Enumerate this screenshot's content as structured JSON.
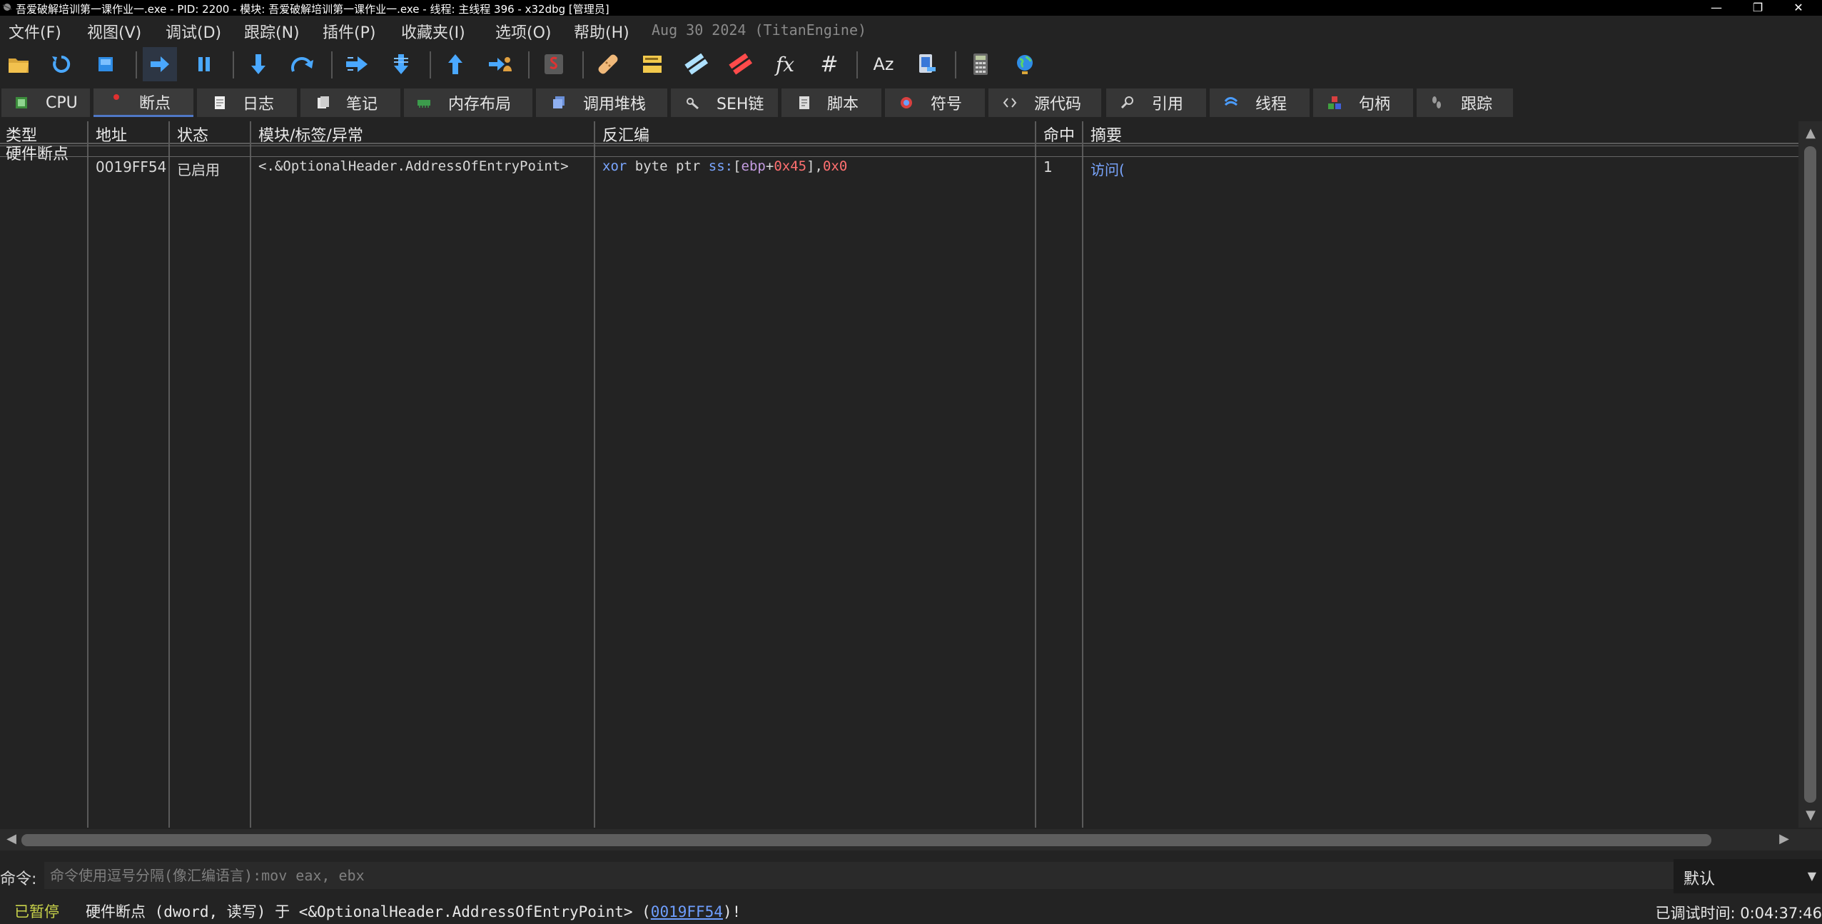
{
  "window": {
    "title": "吾爱破解培训第一课作业一.exe - PID: 2200 - 模块: 吾爱破解培训第一课作业一.exe - 线程: 主线程 396 - x32dbg [管理员]",
    "buttons": {
      "minimize": "—",
      "restore": "❐",
      "close": "✕"
    }
  },
  "menu": {
    "items": [
      "文件(F)",
      "视图(V)",
      "调试(D)",
      "跟踪(N)",
      "插件(P)",
      "收藏夹(I)",
      "选项(O)",
      "帮助(H)"
    ],
    "info": "Aug 30 2024 (TitanEngine)"
  },
  "toolbar": {
    "icons": [
      "open-icon",
      "restart-icon",
      "stop-icon",
      "run-icon",
      "pause-icon",
      "step-into-icon",
      "step-over-icon",
      "trace-into-icon",
      "trace-over-icon",
      "execute-till-return-icon",
      "run-to-user-code-icon",
      "scylla-icon",
      "patch-icon",
      "comment-icon",
      "label-icon",
      "bookmark-icon",
      "function-icon",
      "hash-icon",
      "font-icon",
      "windows-icon",
      "calculator-icon",
      "globe-icon"
    ],
    "fx": "fx",
    "hash": "#",
    "font": "Aᴢ"
  },
  "tabs": [
    {
      "label": "CPU",
      "icon": "cpu-icon"
    },
    {
      "label": "断点",
      "icon": "breakpoint-icon"
    },
    {
      "label": "日志",
      "icon": "log-icon"
    },
    {
      "label": "笔记",
      "icon": "notes-icon"
    },
    {
      "label": "内存布局",
      "icon": "memory-icon"
    },
    {
      "label": "调用堆栈",
      "icon": "callstack-icon"
    },
    {
      "label": "SEH链",
      "icon": "seh-icon"
    },
    {
      "label": "脚本",
      "icon": "script-icon"
    },
    {
      "label": "符号",
      "icon": "symbols-icon"
    },
    {
      "label": "源代码",
      "icon": "source-icon"
    },
    {
      "label": "引用",
      "icon": "references-icon"
    },
    {
      "label": "线程",
      "icon": "threads-icon"
    },
    {
      "label": "句柄",
      "icon": "handles-icon"
    },
    {
      "label": "跟踪",
      "icon": "trace-icon"
    }
  ],
  "active_tab": "断点",
  "breakpoints": {
    "columns": [
      "类型",
      "地址",
      "状态",
      "模块/标签/异常",
      "反汇编",
      "命中",
      "摘要"
    ],
    "group": "硬件断点",
    "row": {
      "address": "0019FF54",
      "state": "已启用",
      "module": "<.&OptionalHeader.AddressOfEntryPoint>",
      "disasm": {
        "mnemonic": "xor",
        "size": "byte ptr",
        "segment": "ss:",
        "open": "[",
        "reg": "ebp",
        "plus": "+",
        "offset": "0x45",
        "close": "],",
        "imm": "0x0"
      },
      "hits": "1",
      "summary": "访问("
    }
  },
  "command": {
    "label": "命令:",
    "placeholder": "命令使用逗号分隔(像汇编语言):mov eax, ebx",
    "value": "",
    "mode": "默认"
  },
  "status": {
    "state": "已暂停",
    "message_prefix": "硬件断点 (dword, 读写) 于 <&OptionalHeader.AddressOfEntryPoint> (",
    "link": "0019FF54",
    "message_suffix": ")!",
    "time": "已调试时间: 0:04:37:46"
  },
  "colors": {
    "background": "#232323",
    "accent": "#4f78c6",
    "mnemonic": "#7aa6ff",
    "register": "#c39ce0",
    "number": "#ff7070",
    "paused": "#c8d24a"
  }
}
